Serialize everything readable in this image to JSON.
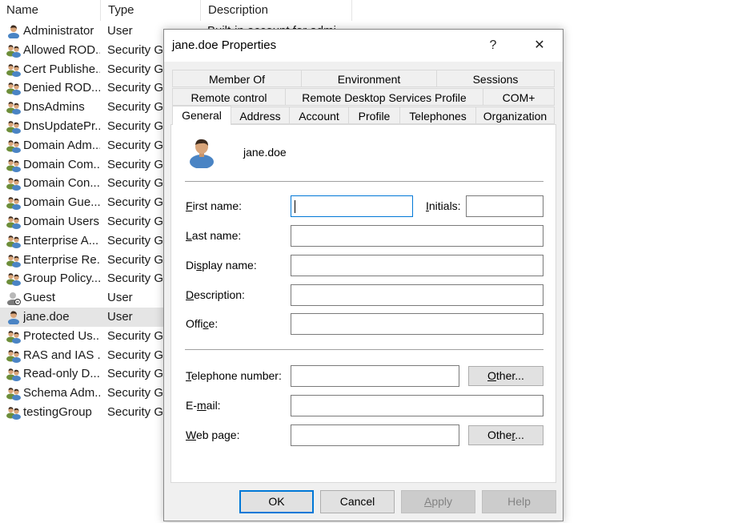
{
  "list": {
    "columns": {
      "name": "Name",
      "type": "Type",
      "description": "Description"
    },
    "rows": [
      {
        "name": "Administrator",
        "type": "User",
        "description": "Built-in account for admi",
        "kind": "user"
      },
      {
        "name": "Allowed ROD...",
        "type": "Security Gr",
        "kind": "group"
      },
      {
        "name": "Cert Publishe...",
        "type": "Security Gr",
        "kind": "group"
      },
      {
        "name": "Denied ROD...",
        "type": "Security Gr",
        "kind": "group"
      },
      {
        "name": "DnsAdmins",
        "type": "Security Gr",
        "kind": "group"
      },
      {
        "name": "DnsUpdatePr...",
        "type": "Security Gr",
        "kind": "group"
      },
      {
        "name": "Domain Adm...",
        "type": "Security Gr",
        "kind": "group"
      },
      {
        "name": "Domain Com...",
        "type": "Security Gr",
        "kind": "group"
      },
      {
        "name": "Domain Con...",
        "type": "Security Gr",
        "kind": "group"
      },
      {
        "name": "Domain Gue...",
        "type": "Security Gr",
        "kind": "group"
      },
      {
        "name": "Domain Users",
        "type": "Security Gr",
        "kind": "group"
      },
      {
        "name": "Enterprise A...",
        "type": "Security Gr",
        "kind": "group"
      },
      {
        "name": "Enterprise Re...",
        "type": "Security Gr",
        "kind": "group"
      },
      {
        "name": "Group Policy...",
        "type": "Security Gr",
        "kind": "group"
      },
      {
        "name": "Guest",
        "type": "User",
        "kind": "user-disabled"
      },
      {
        "name": "jane.doe",
        "type": "User",
        "kind": "user-selected"
      },
      {
        "name": "Protected Us...",
        "type": "Security Gr",
        "kind": "group"
      },
      {
        "name": "RAS and IAS ...",
        "type": "Security Gr",
        "kind": "group"
      },
      {
        "name": "Read-only D...",
        "type": "Security Gr",
        "kind": "group"
      },
      {
        "name": "Schema Adm...",
        "type": "Security Gr",
        "kind": "group"
      },
      {
        "name": "testingGroup",
        "type": "Security Gr",
        "kind": "group"
      }
    ]
  },
  "dialog": {
    "title": "jane.doe Properties",
    "help_glyph": "?",
    "close_glyph": "✕",
    "tabs_row1": [
      "Member Of",
      "Environment",
      "Sessions"
    ],
    "tabs_row2": [
      "Remote control",
      "Remote Desktop Services Profile",
      "COM+"
    ],
    "tabs_row3": [
      "General",
      "Address",
      "Account",
      "Profile",
      "Telephones",
      "Organization"
    ],
    "active_tab": "General",
    "user_name": "jane.doe",
    "fields": {
      "first_name": {
        "prefix": "",
        "key": "F",
        "rest": "irst name:",
        "value": ""
      },
      "initials": {
        "prefix": "",
        "key": "I",
        "rest": "nitials:",
        "value": ""
      },
      "last_name": {
        "prefix": "",
        "key": "L",
        "rest": "ast name:",
        "value": ""
      },
      "display_name": {
        "prefix": "Di",
        "key": "s",
        "rest": "play name:",
        "value": ""
      },
      "description": {
        "prefix": "",
        "key": "D",
        "rest": "escription:",
        "value": ""
      },
      "office": {
        "prefix": "Offi",
        "key": "c",
        "rest": "e:",
        "value": ""
      },
      "telephone": {
        "prefix": "",
        "key": "T",
        "rest": "elephone number:",
        "value": ""
      },
      "email": {
        "prefix": "E-",
        "key": "m",
        "rest": "ail:",
        "value": ""
      },
      "web_page": {
        "prefix": "",
        "key": "W",
        "rest": "eb page:",
        "value": ""
      }
    },
    "other_phone": {
      "prefix": "",
      "key": "O",
      "rest": "ther..."
    },
    "other_web": {
      "prefix": "Othe",
      "key": "r",
      "rest": "..."
    },
    "buttons": {
      "ok": "OK",
      "cancel": "Cancel",
      "apply_key": "A",
      "apply_rest": "pply",
      "help": "Help"
    }
  },
  "colors": {
    "accent": "#0078d7",
    "dialog_bg": "#f0f0f0",
    "selected_row": "#e5e5e5"
  }
}
